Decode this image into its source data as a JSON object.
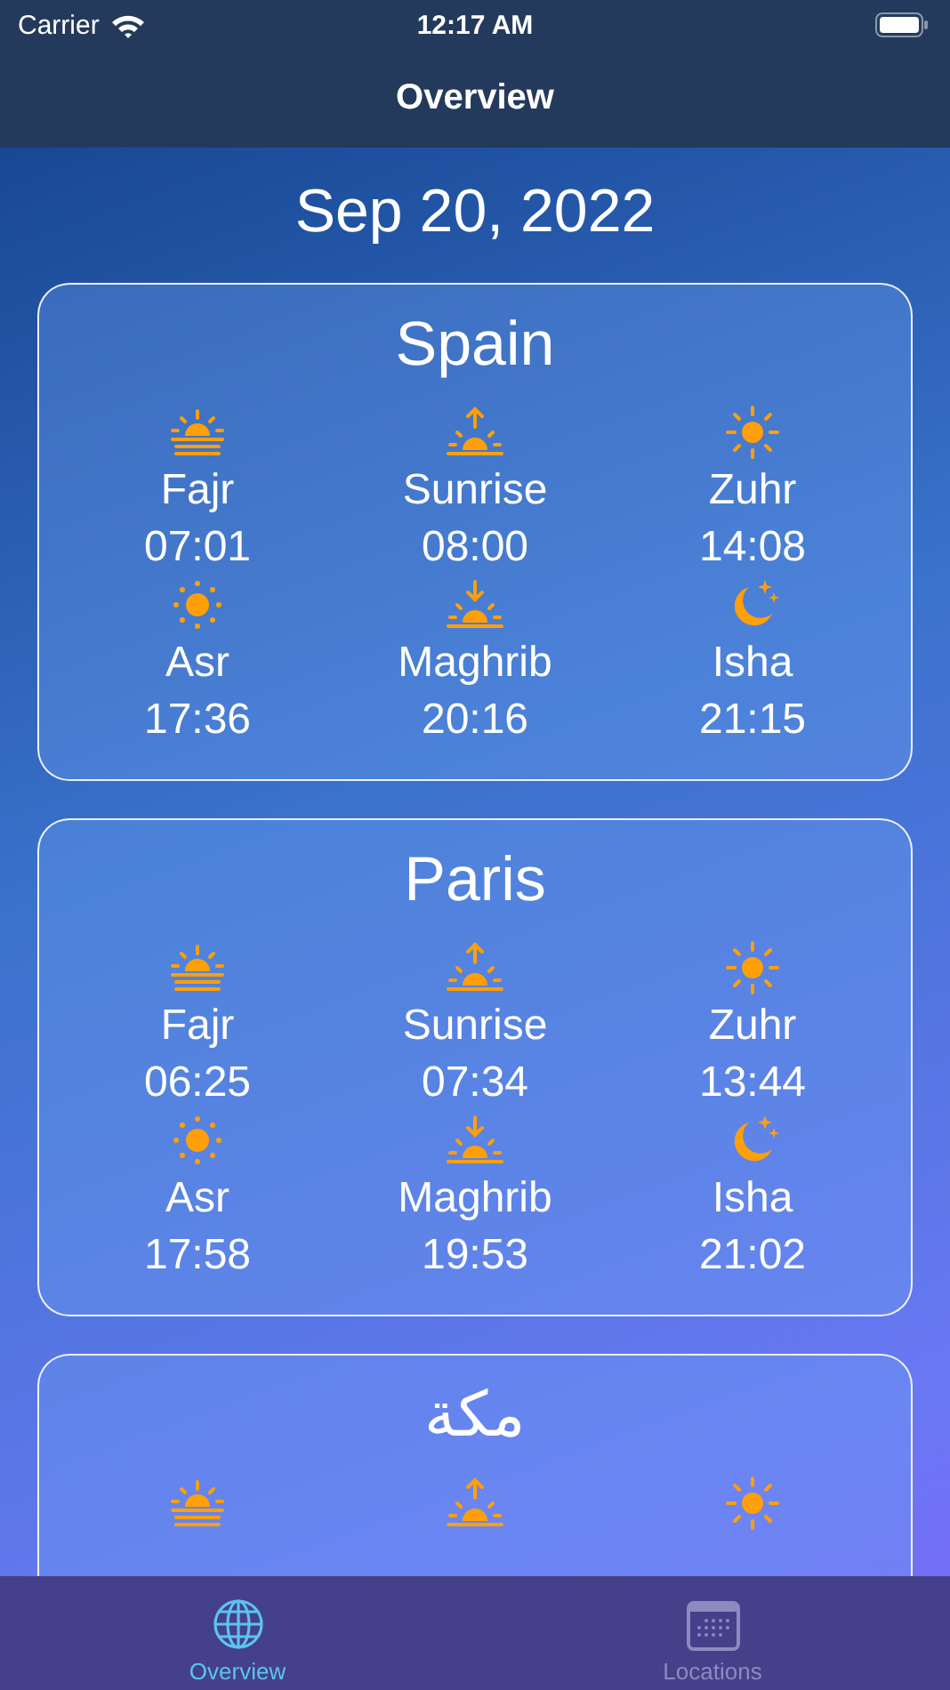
{
  "status_bar": {
    "carrier": "Carrier",
    "time": "12:17 AM"
  },
  "nav": {
    "title": "Overview"
  },
  "date": "Sep 20, 2022",
  "cards": [
    {
      "title": "Spain",
      "prayers": [
        {
          "kind": "fajr",
          "name": "Fajr",
          "time": "07:01"
        },
        {
          "kind": "sunrise",
          "name": "Sunrise",
          "time": "08:00"
        },
        {
          "kind": "zuhr",
          "name": "Zuhr",
          "time": "14:08"
        },
        {
          "kind": "asr",
          "name": "Asr",
          "time": "17:36"
        },
        {
          "kind": "maghrib",
          "name": "Maghrib",
          "time": "20:16"
        },
        {
          "kind": "isha",
          "name": "Isha",
          "time": "21:15"
        }
      ]
    },
    {
      "title": "Paris",
      "prayers": [
        {
          "kind": "fajr",
          "name": "Fajr",
          "time": "06:25"
        },
        {
          "kind": "sunrise",
          "name": "Sunrise",
          "time": "07:34"
        },
        {
          "kind": "zuhr",
          "name": "Zuhr",
          "time": "13:44"
        },
        {
          "kind": "asr",
          "name": "Asr",
          "time": "17:58"
        },
        {
          "kind": "maghrib",
          "name": "Maghrib",
          "time": "19:53"
        },
        {
          "kind": "isha",
          "name": "Isha",
          "time": "21:02"
        }
      ]
    },
    {
      "title": "مكة",
      "prayers": [
        {
          "kind": "fajr"
        },
        {
          "kind": "sunrise"
        },
        {
          "kind": "zuhr"
        }
      ]
    }
  ],
  "tabs": [
    {
      "label": "Overview",
      "kind": "globe",
      "selected": true
    },
    {
      "label": "Locations",
      "kind": "calendar",
      "selected": false
    }
  ]
}
